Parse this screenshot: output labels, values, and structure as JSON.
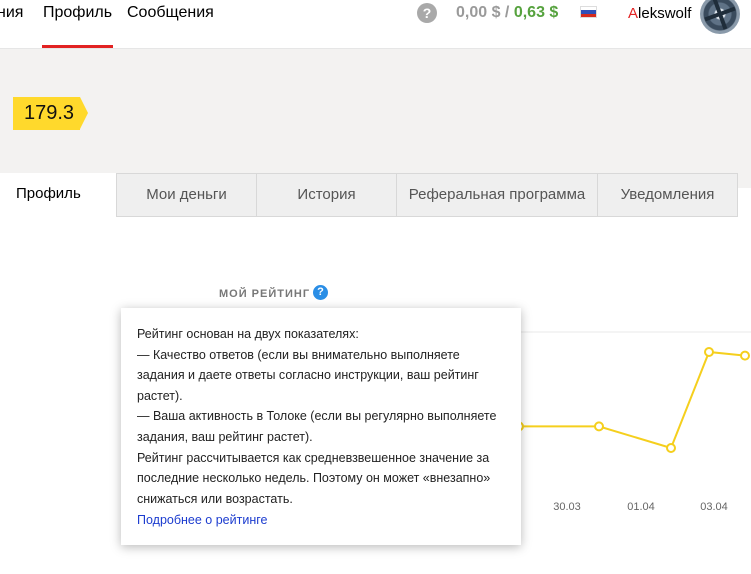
{
  "nav": {
    "items": [
      {
        "label": "ния"
      },
      {
        "label": "Профиль"
      },
      {
        "label": "Сообщения"
      }
    ],
    "help_glyph": "?",
    "balance_main": "0,00 $",
    "balance_sep": " / ",
    "balance_bonus": "0,63 $",
    "username_first": "A",
    "username_rest": "lekswolf",
    "flag_icon": "russia-flag-icon"
  },
  "profile": {
    "rating": "179.3"
  },
  "tabs": [
    {
      "label": "Профиль"
    },
    {
      "label": "Мои деньги"
    },
    {
      "label": "История"
    },
    {
      "label": "Реферальная программа"
    },
    {
      "label": "Уведомления"
    }
  ],
  "rating_section": {
    "label": "МОЙ РЕЙТИНГ",
    "help_glyph": "?"
  },
  "tooltip": {
    "lines": [
      "Рейтинг основан на двух показателях:",
      "— Качество ответов (если вы внимательно выполняете задания и даете ответы согласно инструкции, ваш рейтинг растет).",
      "— Ваша активность в Толоке (если вы регулярно выполняете задания, ваш рейтинг растет).",
      "Рейтинг рассчитывается как средневзвешенное значение за последние несколько недель. Поэтому он может «внезапно» снижаться или возрастать."
    ],
    "link": "Подробнее о рейтинге"
  },
  "colors": {
    "accent_red": "#e22222",
    "rating_yellow": "#ffd92c",
    "bonus_green": "#56a23e",
    "link_blue": "#1c3ccf",
    "help_blue": "#2a8ee6"
  },
  "chart_data": {
    "type": "line",
    "categories": [
      "30.03",
      "01.04",
      "03.04"
    ],
    "series": [
      {
        "points": [
          {
            "x": "30.03 −",
            "y": 0.28
          },
          {
            "x": "30.03 +",
            "y": 0.28
          },
          {
            "x": "01.04 +",
            "y": 0.1
          },
          {
            "x": "03.04 −",
            "y": 0.9
          },
          {
            "x": "03.04 +",
            "y": 0.87
          }
        ]
      }
    ],
    "color": "#f5cf1d",
    "grid": false
  }
}
